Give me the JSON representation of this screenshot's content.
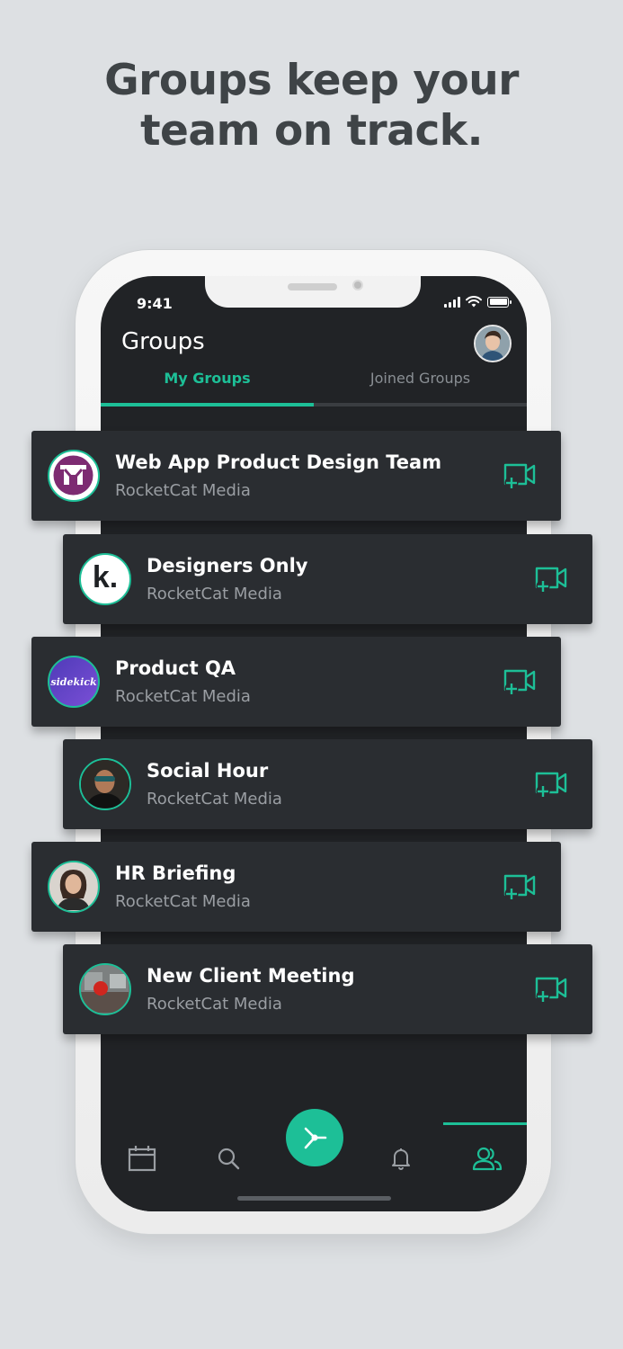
{
  "headline": {
    "line1": "Groups keep your",
    "line2": "team on track."
  },
  "status_bar": {
    "time": "9:41"
  },
  "header": {
    "title": "Groups"
  },
  "tabs": [
    {
      "label": "My Groups",
      "active": true
    },
    {
      "label": "Joined Groups",
      "active": false
    }
  ],
  "groups": [
    {
      "name": "Web App Product Design Team",
      "org": "RocketCat Media",
      "avatar_icon": "w-logo-icon"
    },
    {
      "name": "Designers Only",
      "org": "RocketCat Media",
      "avatar_icon": "k-logo-icon",
      "avatar_text": "k."
    },
    {
      "name": "Product QA",
      "org": "RocketCat Media",
      "avatar_icon": "sidekick-logo-icon",
      "avatar_text": "sidekick"
    },
    {
      "name": "Social Hour",
      "org": "RocketCat Media",
      "avatar_icon": "person-photo-icon"
    },
    {
      "name": "HR Briefing",
      "org": "RocketCat Media",
      "avatar_icon": "person-photo-icon"
    },
    {
      "name": "New Client Meeting",
      "org": "RocketCat Media",
      "avatar_icon": "storefront-photo-icon"
    }
  ],
  "bottom_nav": [
    "calendar-icon",
    "search-icon",
    "share-hub-icon",
    "bell-icon",
    "groups-icon"
  ],
  "colors": {
    "accent": "#1dbf97",
    "screen_bg": "#212326",
    "card_bg": "#2a2d31",
    "page_bg": "#dde0e3"
  }
}
